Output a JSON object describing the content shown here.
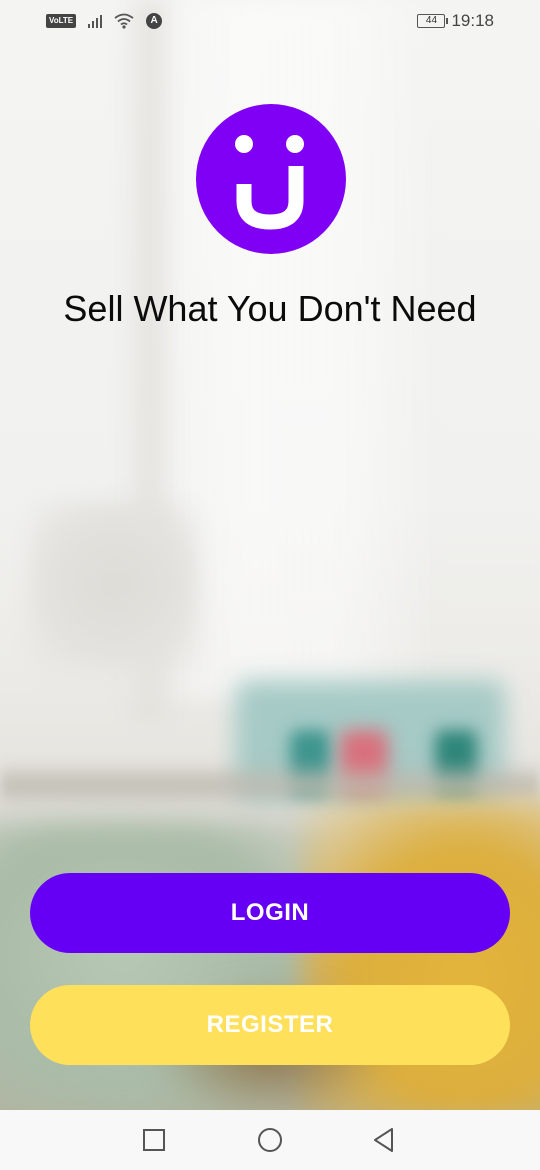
{
  "status_bar": {
    "network_badge": "VoLTE",
    "data_badge": "A",
    "battery_level": "44",
    "time": "19:18",
    "icons": [
      "volte-icon",
      "signal-icon",
      "wifi-icon",
      "data-saver-icon",
      "battery-icon"
    ]
  },
  "brand": {
    "logo_icon": "smiley-j-logo",
    "logo_color": "#8000f5",
    "tagline": "Sell What You Don't Need"
  },
  "actions": {
    "login_label": "LOGIN",
    "login_color": "#6600f5",
    "register_label": "REGISTER",
    "register_color": "#ffe05a"
  },
  "nav_bar": {
    "icons": [
      "recent-apps-icon",
      "home-icon",
      "back-icon"
    ]
  }
}
